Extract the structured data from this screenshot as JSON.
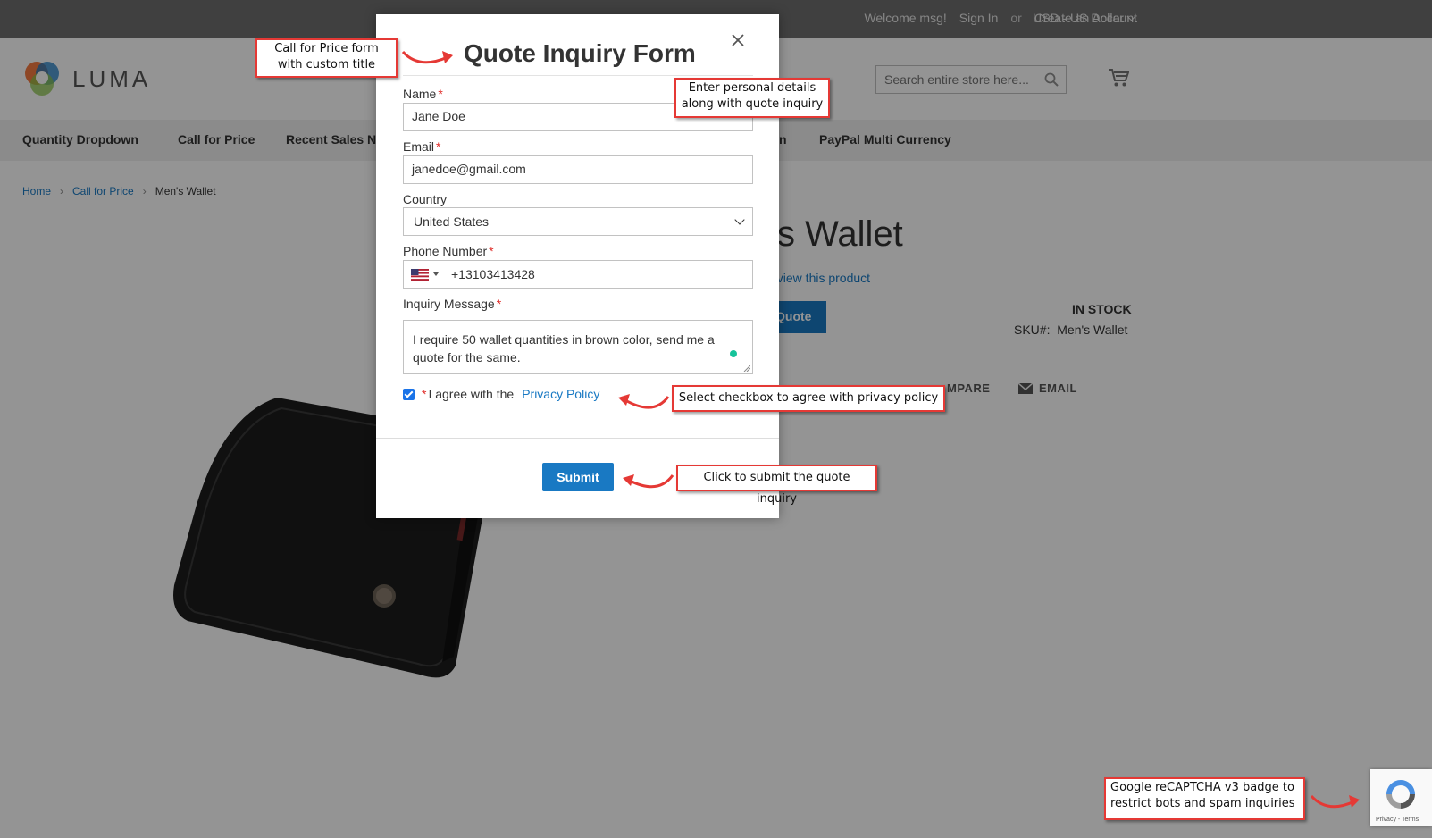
{
  "topbar": {
    "welcome": "Welcome msg!",
    "sign_in": "Sign In",
    "or": "or",
    "create_account": "Create an Account",
    "currency": "USD - US Dollar"
  },
  "header": {
    "logo_text": "LUMA",
    "search_placeholder": "Search entire store here..."
  },
  "nav": {
    "items": [
      "Quantity Dropdown",
      "Call for Price",
      "Recent Sales N",
      "n",
      "PayPal Multi Currency"
    ]
  },
  "breadcrumb": {
    "items": [
      "Home",
      "Call for Price",
      "Men's Wallet"
    ]
  },
  "product": {
    "title_visible": "s Wallet",
    "review_link": "eview this product",
    "quote_button": "Quote",
    "stock": "IN STOCK",
    "sku_label": "SKU#:",
    "sku_value": "Men's Wallet",
    "compare": "MPARE",
    "email": "EMAIL"
  },
  "modal": {
    "title": "Quote Inquiry Form",
    "name_label": "Name",
    "name_value": "Jane Doe",
    "email_label": "Email",
    "email_value": "janedoe@gmail.com",
    "country_label": "Country",
    "country_value": "United States",
    "phone_label": "Phone Number",
    "phone_value": "+13103413428",
    "message_label": "Inquiry Message",
    "message_value": "I require 50 wallet quantities in brown color, send me a quote for the same.",
    "agree_text": "I agree with the",
    "privacy_link": "Privacy Policy",
    "agree_checked": true,
    "submit_label": "Submit",
    "required_marker": "*"
  },
  "recaptcha": {
    "label": "Privacy - Terms"
  },
  "callouts": {
    "title_note": "Call for Price form with custom title",
    "details_note": "Enter personal details along with quote inquiry",
    "checkbox_note": "Select checkbox to agree with privacy policy",
    "submit_note": "Click to submit the quote inquiry",
    "recaptcha_note": "Google reCAPTCHA v3 badge to restrict bots and spam inquiries"
  },
  "colors": {
    "accent": "#1979c3",
    "required": "#e02b27",
    "callout_border": "#e53935",
    "topbar": "#6e6e6e"
  }
}
